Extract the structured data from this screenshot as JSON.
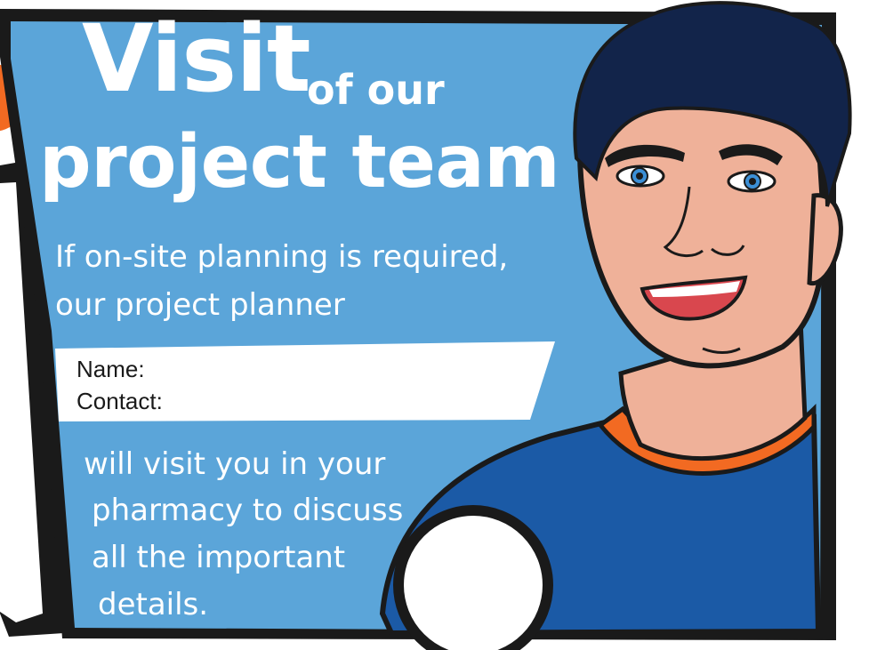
{
  "poster": {
    "title_big": "Visit",
    "title_small": "of our",
    "title_line2": "project team",
    "intro_lines": [
      "If on-site planning is required,",
      "our project planner"
    ],
    "form": {
      "name_label": "Name:",
      "contact_label": "Contact:"
    },
    "body_lines": [
      "will visit you in your",
      "pharmacy to discuss",
      "all the important",
      "details."
    ]
  },
  "colors": {
    "panel_blue": "#5ba5d9",
    "shirt_blue": "#1b5aa6",
    "accent_orange": "#f26a22",
    "outline": "#1a1a1a",
    "skin": "#efb199",
    "hair": "#12244a"
  },
  "icons": {
    "character": "smiling-man-illustration",
    "badge": "blank-circle-badge"
  }
}
